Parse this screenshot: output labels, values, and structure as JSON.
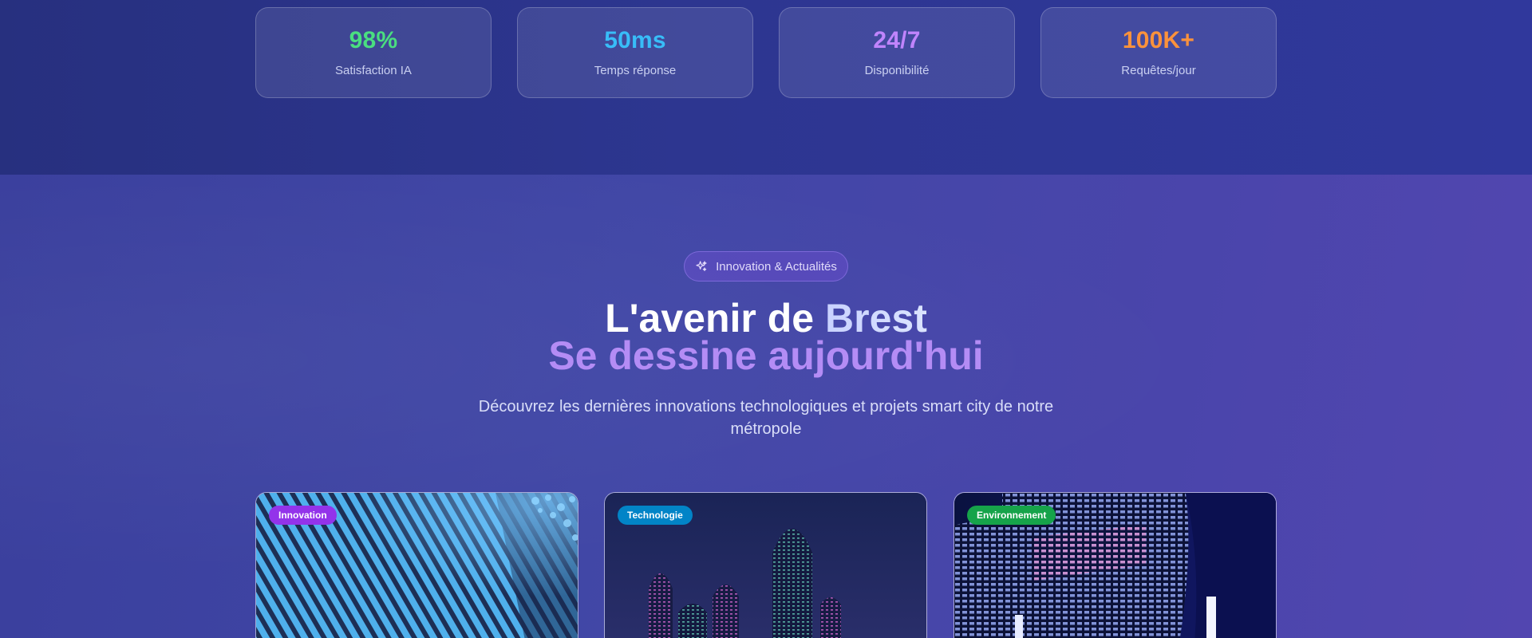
{
  "stats": [
    {
      "value": "98%",
      "label": "Satisfaction IA",
      "color": "#4ade80"
    },
    {
      "value": "50ms",
      "label": "Temps réponse",
      "color": "#38bdf8"
    },
    {
      "value": "24/7",
      "label": "Disponibilité",
      "color": "#c084fc"
    },
    {
      "value": "100K+",
      "label": "Requêtes/jour",
      "color": "#fb923c"
    }
  ],
  "news": {
    "badge": {
      "label": "Innovation & Actualités",
      "icon": "sparkles-icon"
    },
    "title_part1": "L'avenir de ",
    "title_highlight": "Brest",
    "title_line2": "Se dessine aujourd'hui",
    "subtitle": "Découvrez les dernières innovations technologiques et projets smart city de notre métropole",
    "cards": [
      {
        "tag": "Innovation",
        "tag_color": "#9333ea"
      },
      {
        "tag": "Technologie",
        "tag_color": "#0284c7"
      },
      {
        "tag": "Environnement",
        "tag_color": "#16a34a"
      }
    ]
  }
}
